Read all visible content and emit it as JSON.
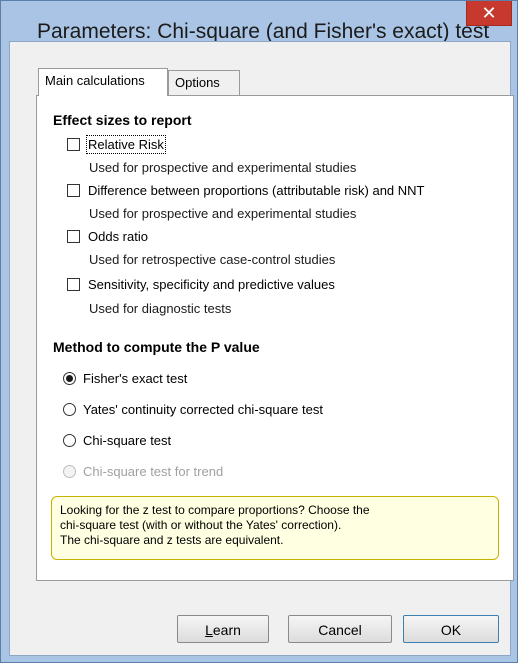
{
  "window": {
    "title": "Parameters: Chi-square (and Fisher's exact) test",
    "close_symbol": "✕"
  },
  "tabs": [
    {
      "label": "Main calculations",
      "active": true
    },
    {
      "label": "Options",
      "active": false
    }
  ],
  "effect_sizes": {
    "heading": "Effect sizes to report",
    "items": [
      {
        "label": "Relative Risk",
        "description": "Used for prospective and experimental studies",
        "checked": false
      },
      {
        "label": "Difference between proportions (attributable risk) and NNT",
        "description": "Used for prospective and experimental studies",
        "checked": false
      },
      {
        "label": "Odds ratio",
        "description": "Used for retrospective case-control studies",
        "checked": false
      },
      {
        "label": "Sensitivity, specificity and predictive values",
        "description": "Used for diagnostic tests",
        "checked": false
      }
    ]
  },
  "p_value_method": {
    "heading": "Method to compute the P value",
    "options": [
      {
        "label": "Fisher's exact test",
        "selected": true,
        "enabled": true
      },
      {
        "label": "Yates' continuity corrected chi-square test",
        "selected": false,
        "enabled": true
      },
      {
        "label": "Chi-square test",
        "selected": false,
        "enabled": true
      },
      {
        "label": "Chi-square test for trend",
        "selected": false,
        "enabled": false
      }
    ]
  },
  "note": {
    "lines": [
      "Looking for the z test to compare proportions? Choose the",
      "chi-square test (with or without the Yates' correction).",
      "The chi-square and z tests are equivalent."
    ]
  },
  "buttons": {
    "learn_first": "L",
    "learn_rest": "earn",
    "cancel": "Cancel",
    "ok": "OK"
  },
  "colors": {
    "title_bar": "#a9c4e4",
    "close_button": "#c7392f",
    "note_background": "#ffffe1",
    "note_border": "#c8b400"
  }
}
